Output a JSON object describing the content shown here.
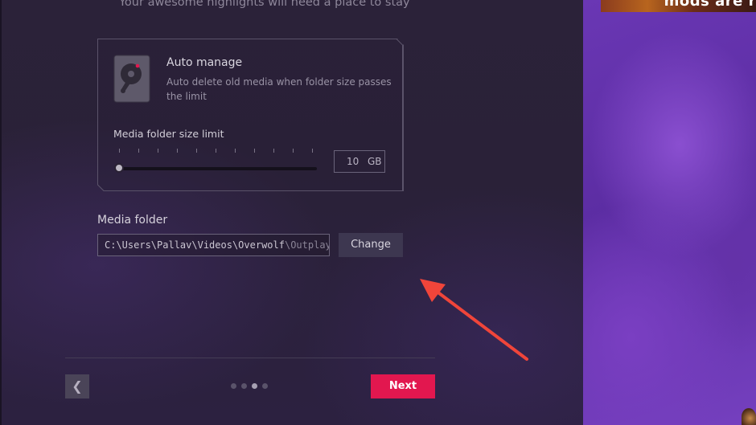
{
  "header": {
    "subtitle": "Your awesome highlights will need a place to stay"
  },
  "auto_manage": {
    "icon": "hard-disk-icon",
    "title": "Auto manage",
    "description": "Auto delete old media when folder size passes the limit"
  },
  "size_limit": {
    "label": "Media folder size limit",
    "value": "10",
    "unit": "GB",
    "slider_fraction": 0
  },
  "media_folder": {
    "label": "Media folder",
    "path_main": "C:\\Users\\Pallav\\Videos\\Overwolf",
    "path_tail": "\\Outplayed",
    "change_label": "Change"
  },
  "footer": {
    "back_label": "❮",
    "next_label": "Next",
    "dots_total": 4,
    "dots_active_index": 2
  },
  "right_panel": {
    "thumb_text": "mods are r"
  },
  "colors": {
    "accent": "#e2174f",
    "annotation_arrow": "#f0453a",
    "background": "#2a2138",
    "promo_purple": "#6a37b4"
  }
}
